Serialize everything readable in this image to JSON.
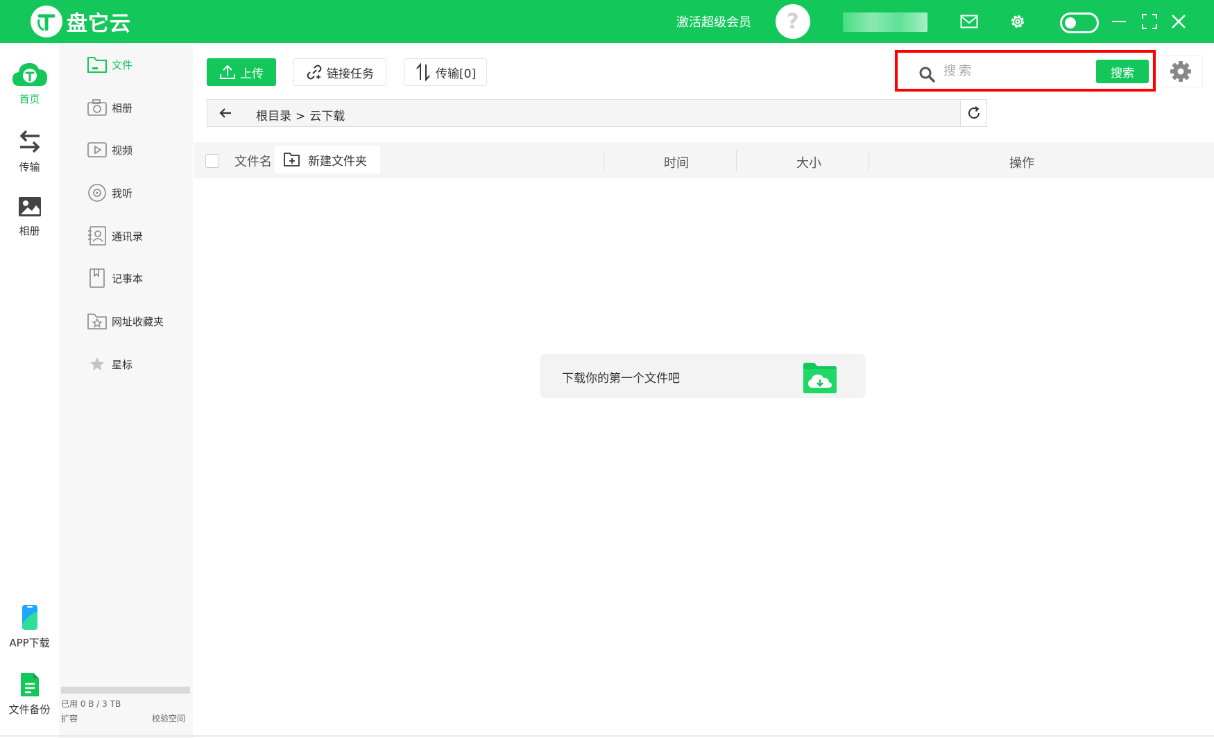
{
  "app": {
    "name": "盘它云"
  },
  "titlebar": {
    "vip_label": "激活超级会员",
    "avatar_glyph": "?",
    "icons": [
      "mail-icon",
      "gear-icon",
      "toggle-switch",
      "minimize-icon",
      "maximize-icon",
      "close-icon"
    ]
  },
  "rail": {
    "items": [
      {
        "label": "首页",
        "icon": "cloud-home-icon",
        "active": true
      },
      {
        "label": "传输",
        "icon": "transfer-arrows-icon",
        "active": false
      },
      {
        "label": "相册",
        "icon": "image-icon",
        "active": false
      },
      {
        "label": "APP下载",
        "icon": "phone-app-icon",
        "active": false
      },
      {
        "label": "文件备份",
        "icon": "document-backup-icon",
        "active": false
      }
    ]
  },
  "sidebar": {
    "items": [
      {
        "label": "文件",
        "icon": "folder-icon",
        "active": true
      },
      {
        "label": "相册",
        "icon": "camera-icon"
      },
      {
        "label": "视频",
        "icon": "video-icon"
      },
      {
        "label": "我听",
        "icon": "music-disc-icon"
      },
      {
        "label": "通讯录",
        "icon": "contacts-icon"
      },
      {
        "label": "记事本",
        "icon": "notebook-icon"
      },
      {
        "label": "网址收藏夹",
        "icon": "bookmark-folder-icon"
      },
      {
        "label": "星标",
        "icon": "star-icon"
      }
    ],
    "storage": {
      "text": "已用 0 B / 3 TB",
      "used_fraction": 0.0
    },
    "expand_label": "扩容",
    "check_label": "校验空间"
  },
  "toolbar": {
    "upload_label": "上传",
    "link_task_label": "链接任务",
    "transfer_label": "传输[0]"
  },
  "search": {
    "placeholder": "搜索",
    "button_label": "搜索"
  },
  "breadcrumb": {
    "root": "根目录",
    "separator": ">",
    "current": "云下载"
  },
  "table": {
    "col_name": "文件名",
    "new_folder_label": "新建文件夹",
    "col_time": "时间",
    "col_size": "大小",
    "col_actions": "操作"
  },
  "empty_state": {
    "text": "下载你的第一个文件吧"
  },
  "colors": {
    "brand": "#14c75a",
    "highlight": "#ff0000"
  }
}
